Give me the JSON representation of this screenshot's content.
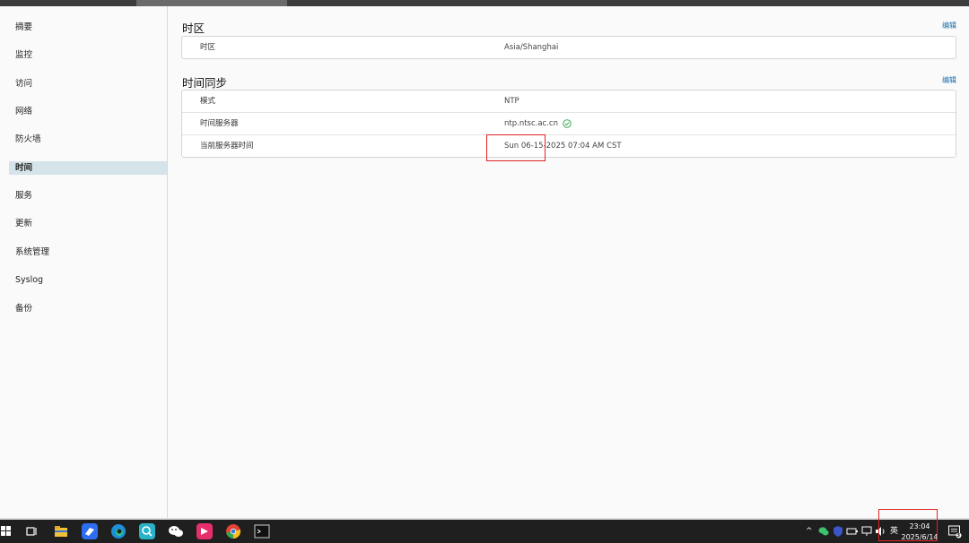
{
  "sidebar": {
    "items": [
      "摘要",
      "监控",
      "访问",
      "网络",
      "防火墙",
      "时间",
      "服务",
      "更新",
      "系统管理",
      "Syslog",
      "备份"
    ],
    "active_index": 5
  },
  "timezone_section": {
    "title": "时区",
    "edit_label": "编辑",
    "rows": [
      {
        "label": "时区",
        "value": "Asia/Shanghai"
      }
    ]
  },
  "time_sync_section": {
    "title": "时间同步",
    "edit_label": "编辑",
    "rows": [
      {
        "label": "模式",
        "value": "NTP"
      },
      {
        "label": "时间服务器",
        "value": "ntp.ntsc.ac.cn",
        "status_icon": "check-circle-icon"
      },
      {
        "label": "当前服务器时间",
        "value": "Sun 06-15-2025 07:04 AM CST"
      }
    ]
  },
  "taskbar": {
    "apps": [
      "windows-start-icon",
      "task-view-icon",
      "file-explorer-icon",
      "feishu-icon",
      "edge-icon",
      "search-app-icon",
      "wechat-icon",
      "app-icon",
      "chrome-icon",
      "terminal-icon"
    ],
    "tray": {
      "ime_label": "英",
      "time": "23:04",
      "date": "2025/6/14",
      "notification_count": "3"
    }
  },
  "colors": {
    "accent_link": "#1b6fa8",
    "active_sidebar": "#d5e3ea",
    "highlight_box": "#e02424",
    "status_ok": "#3aa655"
  }
}
